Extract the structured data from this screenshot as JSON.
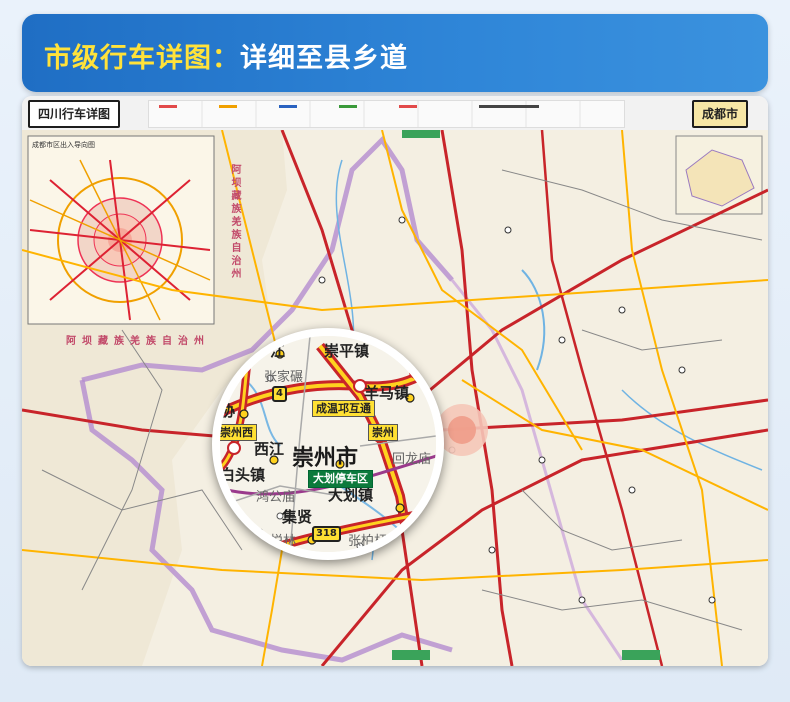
{
  "banner": {
    "title_highlight": "市级行车详图：",
    "title_rest": "详细至县乡道"
  },
  "map": {
    "left_tab": "四川行车详图",
    "right_tab": "成都市",
    "inset_label": "成都市区出入导向图",
    "region_vertical": "阿坝藏族羌族自治州",
    "region_horizontal": "阿坝藏族羌族自治州"
  },
  "magnifier": {
    "city": "崇州市",
    "places": {
      "jiang": "江",
      "chongping": "崇平镇",
      "zhangjiayan": "张家碾",
      "yangma": "羊马镇",
      "xie": "协",
      "xijiang": "西江",
      "baitou": "白头镇",
      "zhen": "镇",
      "hongong": "鸿公庙",
      "jixian": "集贤",
      "dahua": "大划镇",
      "zhenb": "镇",
      "huilin": "悦林",
      "zhangbaishan": "张柏杆",
      "huilongmiao": "回龙庙"
    },
    "labels": {
      "interchange": "成温邛互通",
      "chongzhou_west": "崇州西",
      "chongzhou": "崇州",
      "service_area": "大划停车区",
      "route_318": "318",
      "route_4": "4"
    }
  },
  "colors": {
    "banner_blue": "#2f86d8",
    "title_yellow": "#ffe23a",
    "expressway_red": "#c8242a",
    "road_yellow": "#ffd21f"
  }
}
